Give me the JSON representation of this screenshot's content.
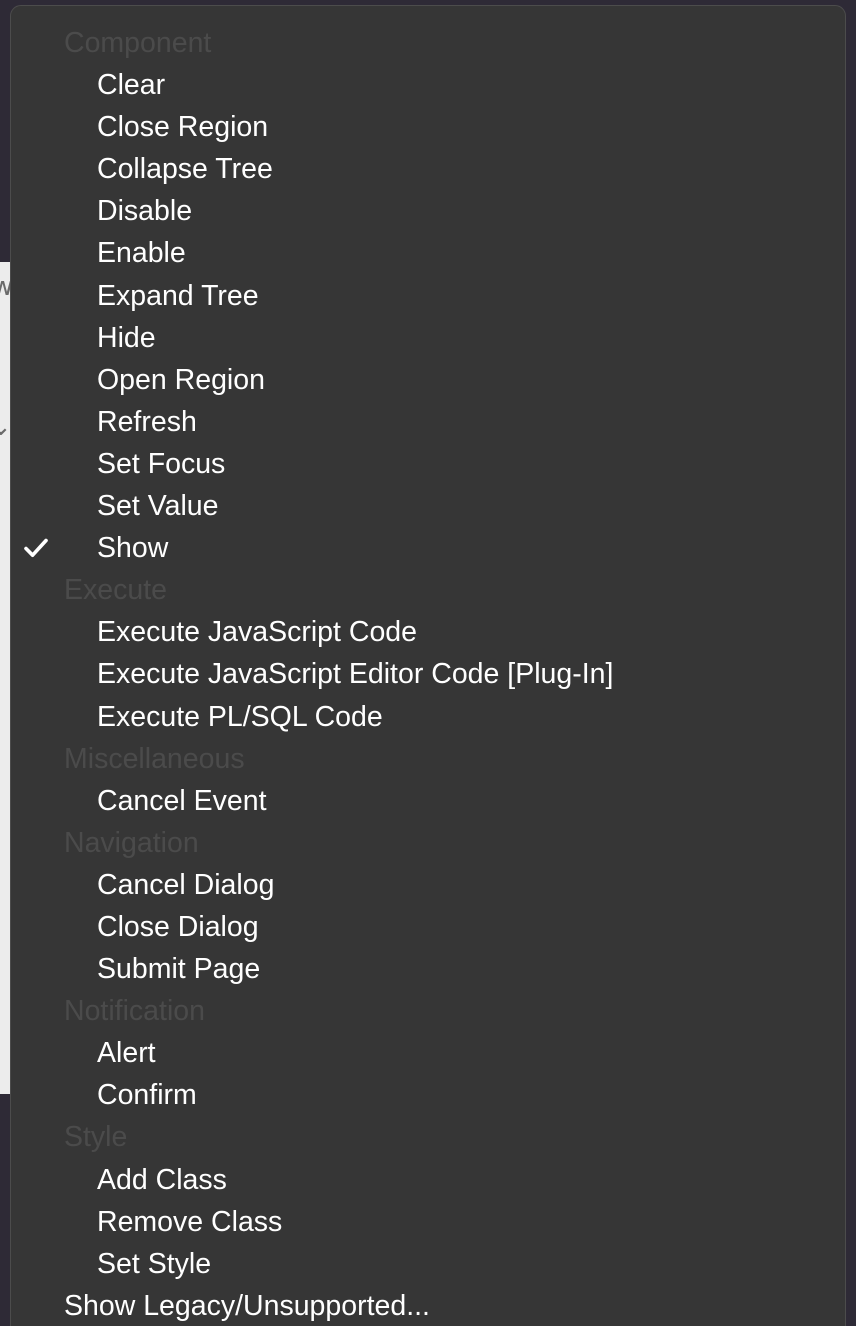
{
  "background": {
    "glyph_top": "w",
    "glyph_bottom": "⌄"
  },
  "menu": {
    "groups": [
      {
        "header": "Component",
        "items": [
          "Clear",
          "Close Region",
          "Collapse Tree",
          "Disable",
          "Enable",
          "Expand Tree",
          "Hide",
          "Open Region",
          "Refresh",
          "Set Focus",
          "Set Value",
          "Show"
        ]
      },
      {
        "header": "Execute",
        "items": [
          "Execute JavaScript Code",
          "Execute JavaScript Editor Code [Plug-In]",
          "Execute PL/SQL Code"
        ]
      },
      {
        "header": "Miscellaneous",
        "items": [
          "Cancel Event"
        ]
      },
      {
        "header": "Navigation",
        "items": [
          "Cancel Dialog",
          "Close Dialog",
          "Submit Page"
        ]
      },
      {
        "header": "Notification",
        "items": [
          "Alert",
          "Confirm"
        ]
      },
      {
        "header": "Style",
        "items": [
          "Add Class",
          "Remove Class",
          "Set Style"
        ]
      }
    ],
    "selected_item": "Show",
    "footer_item": "Show Legacy/Unsupported...",
    "colors": {
      "menu_background": "#363636",
      "item_text": "#ffffff",
      "group_header_text": "#4b4b4b",
      "checkmark": "#ffffff"
    },
    "icons": {
      "selected": "checkmark-icon"
    }
  }
}
